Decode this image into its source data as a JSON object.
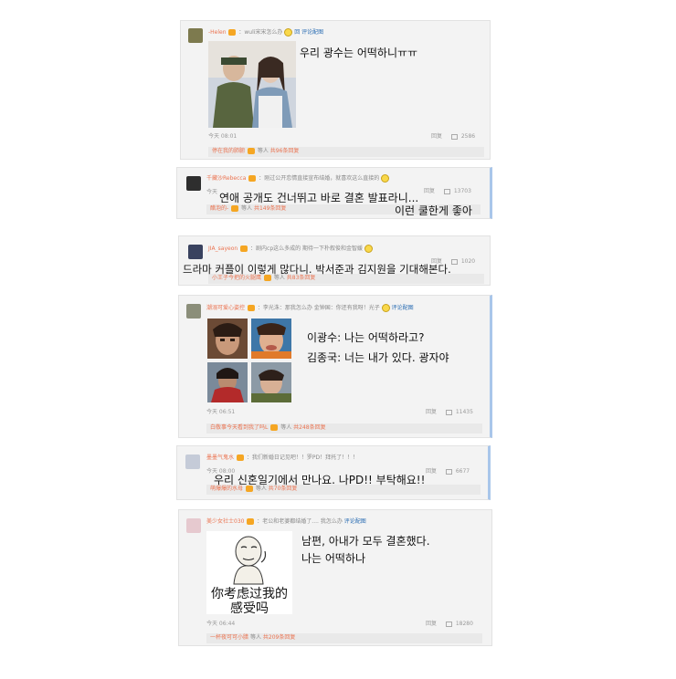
{
  "colors": {
    "card_bg": "#f3f3f3",
    "username": "#eb7350",
    "highlight_border": "#a9c6ea",
    "link": "#2a6db3"
  },
  "comments": [
    {
      "user": "-Helen",
      "snippet": "：wuli宋宋怎么办",
      "reply_link": "回 评论配图",
      "time": "今天 08:01",
      "reply": "回复",
      "likes": "2586",
      "sub_user": "停在我的肺腑",
      "sub_text": "等人",
      "sub_count": "共96条回复",
      "overlay": "우리 광수는 어떡하니ㅠㅠ"
    },
    {
      "user": "千藏沙Rebecca",
      "snippet": "：刚过公开恋情直接宣布结婚，就喜欢这么直接的",
      "time": "今天",
      "reply": "回复",
      "likes": "13703",
      "sub_user": "醋泡的-",
      "sub_text": "等人",
      "sub_count": "共149条回复",
      "overlay1": "연애 공개도 건너뛰고 바로 결혼 발표라니...",
      "overlay2": "이런 쿨한게 좋아"
    },
    {
      "user": "JIA_sayeon",
      "snippet": "：剧内cp这么多成的 期待一下朴叙俊和金智媛",
      "reply": "回复",
      "likes": "1020",
      "sub_user": "小王子今把的火腿鹰",
      "sub_text": "等人",
      "sub_count": "共83条回复",
      "overlay": "드라마 커플이 이렇게 많다니. 박서준과 김지원을 기대해본다."
    },
    {
      "user": "潮溺可爱心姿控",
      "snippet": "：李光洙：那我怎么办 金钟国：你还有我呀！光子",
      "reply_link": "评论配图",
      "time": "今天 06:51",
      "reply": "回复",
      "likes": "11435",
      "sub_user": "白敬事今天看到我了吗L",
      "sub_text": "等人",
      "sub_count": "共248条回复",
      "overlay1": "이광수: 나는 어떡하라고?",
      "overlay2": "김종국: 너는 내가 있다. 광자야"
    },
    {
      "user": "墨墨气鬼水",
      "snippet": "：我们新婚日记见吧！！罗PD！拜托了！！！",
      "time": "今天 08:00",
      "reply": "回复",
      "likes": "6677",
      "sub_user": "萌爆爆的水母",
      "sub_text": "等人",
      "sub_count": "共70条回复",
      "overlay": "우리 신혼일기에서 만나요. 나PD!! 부탁해요!!"
    },
    {
      "user": "美少女社士030",
      "snippet": "：老公和老婆都结婚了.... 我怎么办",
      "reply_link": "评论配图",
      "time": "今天 06:44",
      "reply": "回复",
      "likes": "18280",
      "sub_user": "一杯夜可可小腊",
      "sub_text": "等人",
      "sub_count": "共209条回复",
      "overlay1": "남편, 아내가 모두 결혼했다.",
      "overlay2": "나는 어떡하나",
      "meme_line1": "你考虑过我的",
      "meme_line2": "感受吗"
    }
  ]
}
